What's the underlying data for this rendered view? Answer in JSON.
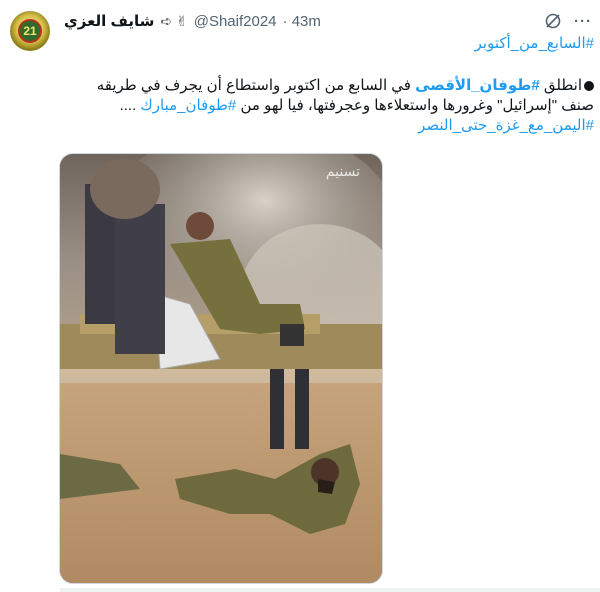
{
  "author": {
    "display_name": "شايف العزي",
    "name_emojis": "➪ ✌",
    "handle": "@Shaif2024",
    "time": "· 43m",
    "avatar_text": "21"
  },
  "header": {
    "grok_icon": "grok-icon",
    "more_label": "···"
  },
  "tweet": {
    "hashtag_top": "#السابع_من_أكتوبر",
    "line1_start": "انطلق ",
    "line1_hashtag": "#طوفان_الأقصى",
    "line1_rest": " في السابع من اكتوبر واستطاع أن يجرف في طريقه",
    "line2": "صنف \"إسرائيل\" وغرورها واستعلاءها وعجرفتها، فيا لهو من ",
    "line2_hashtag": "#طوفان_مبارك",
    "line2_end": " ....",
    "hashtag_bottom": "#اليمن_مع_غزة_حتى_النصر"
  },
  "media": {
    "watermark": "تسنیم"
  }
}
